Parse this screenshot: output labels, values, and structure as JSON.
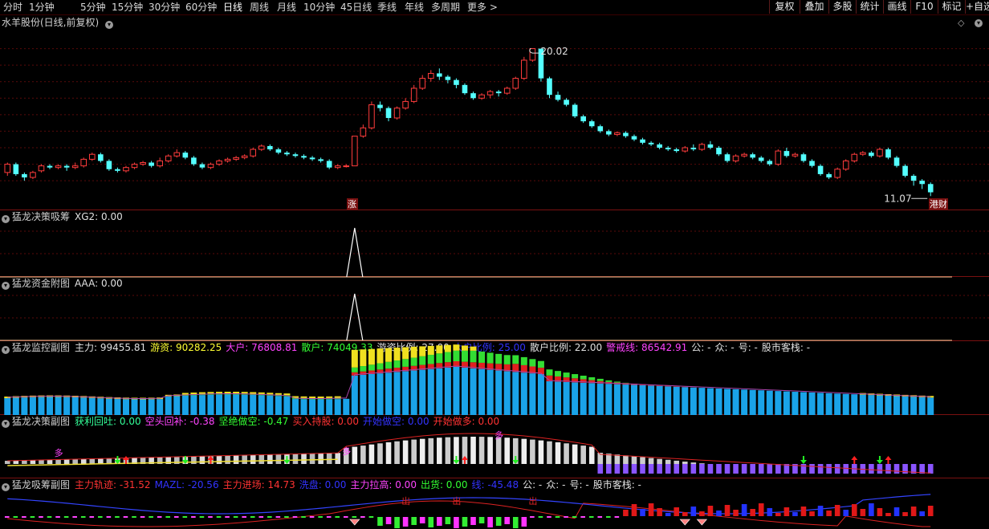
{
  "toolbar": {
    "periods": [
      "分时",
      "1分钟",
      "5分钟",
      "15分钟",
      "30分钟",
      "60分钟",
      "日线",
      "周线",
      "月线",
      "10分钟",
      "45日线",
      "季线",
      "年线",
      "多周期",
      "更多 >"
    ],
    "active_period": "日线",
    "right_buttons": [
      "复权",
      "叠加",
      "多股",
      "统计",
      "画线",
      "F10",
      "标记",
      "+自选"
    ]
  },
  "main_panel": {
    "stock_title": "水羊股份(日线,前复权)",
    "high_label": "20.02",
    "low_label": "11.07",
    "zhang_badge": "涨",
    "finance_badge": "港财",
    "colors": {
      "up": "#ff3c3c",
      "down": "#54ffff",
      "bg": "#000000",
      "grid": "#5a0a0a"
    }
  },
  "panels": {
    "xg2": {
      "name": "猛龙决策吸筹",
      "items": [
        {
          "label": "XG2:",
          "value": "0.00",
          "color": "#e0e0e0"
        }
      ]
    },
    "aaa": {
      "name": "猛龙资金附图",
      "items": [
        {
          "label": "AAA:",
          "value": "0.00",
          "color": "#e0e0e0"
        }
      ]
    },
    "monitor": {
      "name": "猛龙监控副图",
      "items": [
        {
          "label": "主力:",
          "value": "99455.81",
          "color": "#e0e0e0"
        },
        {
          "label": "游资:",
          "value": "90282.25",
          "color": "#ffff33"
        },
        {
          "label": "大户:",
          "value": "76808.81",
          "color": "#ff44ff"
        },
        {
          "label": "散户:",
          "value": "74049.33",
          "color": "#33ff33"
        },
        {
          "label": "游资比例:",
          "value": "27.00",
          "color": "#e0e0e0"
        },
        {
          "label": "大户比例:",
          "value": "25.00",
          "color": "#3333ff"
        },
        {
          "label": "散户比例:",
          "value": "22.00",
          "color": "#e0e0e0"
        },
        {
          "label": "警戒线:",
          "value": "86542.91",
          "color": "#ff44ff"
        },
        {
          "label": "公:",
          "value": "-",
          "color": "#e0e0e0"
        },
        {
          "label": "众:",
          "value": "-",
          "color": "#e0e0e0"
        },
        {
          "label": "号:",
          "value": "-",
          "color": "#e0e0e0"
        },
        {
          "label": "股市客栈:",
          "value": "-",
          "color": "#e0e0e0"
        }
      ]
    },
    "decision": {
      "name": "猛龙决策副图",
      "items": [
        {
          "label": "获利回吐:",
          "value": "0.00",
          "color": "#33ff99"
        },
        {
          "label": "空头回补:",
          "value": "-0.38",
          "color": "#ff44ff"
        },
        {
          "label": "坚绝做空:",
          "value": "-0.47",
          "color": "#33ff33"
        },
        {
          "label": "买入持股:",
          "value": "0.00",
          "color": "#ff3333"
        },
        {
          "label": "开始做空:",
          "value": "0.00",
          "color": "#3333ff"
        },
        {
          "label": "开始做多:",
          "value": "0.00",
          "color": "#ff3333"
        }
      ]
    },
    "absorb": {
      "name": "猛龙吸筹副图",
      "items": [
        {
          "label": "主力轨迹:",
          "value": "-31.52",
          "color": "#ff3333"
        },
        {
          "label": "MAZL:",
          "value": "-20.56",
          "color": "#3333ff"
        },
        {
          "label": "主力进场:",
          "value": "14.73",
          "color": "#ff3333"
        },
        {
          "label": "洗盘:",
          "value": "0.00",
          "color": "#3333ff"
        },
        {
          "label": "主力拉高:",
          "value": "0.00",
          "color": "#ff44ff"
        },
        {
          "label": "出货:",
          "value": "0.00",
          "color": "#33ff33"
        },
        {
          "label": "线:",
          "value": "-45.48",
          "color": "#3333ff"
        },
        {
          "label": "公:",
          "value": "-",
          "color": "#e0e0e0"
        },
        {
          "label": "众:",
          "value": "-",
          "color": "#e0e0e0"
        },
        {
          "label": "号:",
          "value": "-",
          "color": "#e0e0e0"
        },
        {
          "label": "股市客栈:",
          "value": "-",
          "color": "#e0e0e0"
        }
      ]
    }
  },
  "decision_marks": {
    "duo": "多",
    "chu": "出"
  },
  "chart_data": {
    "type": "candlestick",
    "price_ylim": [
      10.5,
      21.0
    ],
    "high": 20.02,
    "low": 11.07,
    "candles": [
      [
        12.5,
        13.0,
        12.3,
        13.1
      ],
      [
        13.0,
        12.4,
        12.3,
        13.1
      ],
      [
        12.4,
        12.2,
        12.0,
        12.5
      ],
      [
        12.2,
        12.5,
        12.1,
        12.6
      ],
      [
        12.6,
        12.9,
        12.5,
        13.0
      ],
      [
        12.9,
        12.8,
        12.7,
        13.0
      ],
      [
        12.8,
        12.9,
        12.7,
        13.0
      ],
      [
        12.9,
        12.8,
        12.6,
        13.0
      ],
      [
        12.8,
        12.9,
        12.7,
        13.1
      ],
      [
        12.9,
        13.3,
        12.8,
        13.4
      ],
      [
        13.3,
        13.6,
        13.2,
        13.7
      ],
      [
        13.6,
        13.2,
        13.1,
        13.7
      ],
      [
        13.2,
        12.7,
        12.6,
        13.3
      ],
      [
        12.7,
        12.6,
        12.5,
        12.8
      ],
      [
        12.6,
        12.8,
        12.5,
        12.9
      ],
      [
        12.8,
        13.0,
        12.7,
        13.1
      ],
      [
        13.0,
        13.1,
        12.9,
        13.2
      ],
      [
        13.1,
        12.9,
        12.8,
        13.2
      ],
      [
        12.9,
        13.2,
        12.8,
        13.4
      ],
      [
        13.2,
        13.5,
        13.1,
        13.6
      ],
      [
        13.5,
        13.7,
        13.4,
        13.9
      ],
      [
        13.7,
        13.4,
        13.3,
        13.8
      ],
      [
        13.4,
        13.0,
        12.9,
        13.5
      ],
      [
        13.0,
        12.8,
        12.7,
        13.1
      ],
      [
        12.8,
        13.0,
        12.7,
        13.1
      ],
      [
        13.0,
        13.2,
        12.9,
        13.3
      ],
      [
        13.2,
        13.3,
        13.1,
        13.4
      ],
      [
        13.3,
        13.4,
        13.2,
        13.5
      ],
      [
        13.4,
        13.5,
        13.3,
        13.6
      ],
      [
        13.5,
        13.9,
        13.4,
        14.0
      ],
      [
        13.9,
        14.1,
        13.8,
        14.2
      ],
      [
        14.1,
        13.9,
        13.8,
        14.2
      ],
      [
        13.9,
        13.7,
        13.6,
        14.0
      ],
      [
        13.7,
        13.6,
        13.5,
        13.8
      ],
      [
        13.6,
        13.5,
        13.4,
        13.7
      ],
      [
        13.5,
        13.4,
        13.3,
        13.6
      ],
      [
        13.4,
        13.3,
        13.2,
        13.5
      ],
      [
        13.3,
        13.2,
        13.1,
        13.4
      ],
      [
        13.2,
        12.8,
        12.7,
        13.3
      ],
      [
        12.8,
        12.9,
        12.7,
        13.0
      ],
      [
        12.9,
        12.9,
        12.8,
        13.0
      ],
      [
        12.9,
        14.7,
        12.9,
        14.7
      ],
      [
        14.7,
        15.2,
        14.6,
        15.4
      ],
      [
        15.2,
        16.6,
        15.1,
        16.8
      ],
      [
        16.6,
        16.4,
        16.2,
        16.8
      ],
      [
        16.4,
        15.8,
        15.6,
        16.5
      ],
      [
        15.8,
        16.4,
        15.7,
        16.5
      ],
      [
        16.4,
        16.8,
        16.3,
        17.0
      ],
      [
        16.8,
        17.6,
        16.7,
        17.8
      ],
      [
        17.6,
        18.2,
        17.5,
        18.4
      ],
      [
        18.2,
        18.5,
        18.0,
        18.7
      ],
      [
        18.5,
        18.3,
        18.1,
        18.8
      ],
      [
        18.3,
        18.1,
        17.9,
        18.4
      ],
      [
        18.1,
        17.8,
        17.6,
        18.2
      ],
      [
        17.8,
        17.3,
        17.2,
        17.9
      ],
      [
        17.3,
        17.0,
        16.9,
        17.4
      ],
      [
        17.0,
        17.2,
        16.9,
        17.3
      ],
      [
        17.2,
        17.4,
        17.0,
        17.5
      ],
      [
        17.4,
        17.3,
        17.1,
        17.5
      ],
      [
        17.3,
        17.6,
        17.2,
        17.7
      ],
      [
        17.6,
        18.2,
        17.5,
        18.3
      ],
      [
        18.2,
        19.3,
        18.1,
        19.5
      ],
      [
        19.3,
        20.0,
        19.2,
        20.02
      ],
      [
        20.0,
        18.2,
        18.0,
        20.0
      ],
      [
        18.2,
        17.2,
        17.0,
        18.3
      ],
      [
        17.2,
        16.9,
        16.8,
        17.4
      ],
      [
        16.9,
        16.6,
        16.5,
        17.0
      ],
      [
        16.6,
        15.9,
        15.8,
        16.7
      ],
      [
        15.9,
        15.6,
        15.5,
        16.0
      ],
      [
        15.6,
        15.3,
        15.2,
        15.7
      ],
      [
        15.3,
        15.0,
        14.9,
        15.4
      ],
      [
        15.0,
        14.8,
        14.7,
        15.1
      ],
      [
        14.8,
        14.9,
        14.7,
        15.0
      ],
      [
        14.9,
        14.7,
        14.6,
        15.0
      ],
      [
        14.7,
        14.5,
        14.4,
        14.8
      ],
      [
        14.5,
        14.3,
        14.2,
        14.6
      ],
      [
        14.3,
        14.2,
        14.1,
        14.4
      ],
      [
        14.2,
        14.0,
        13.9,
        14.3
      ],
      [
        14.0,
        13.9,
        13.8,
        14.1
      ],
      [
        13.9,
        13.8,
        13.7,
        14.0
      ],
      [
        13.8,
        14.0,
        13.7,
        14.1
      ],
      [
        14.0,
        13.9,
        13.8,
        14.2
      ],
      [
        13.9,
        14.2,
        13.8,
        14.3
      ],
      [
        14.2,
        14.0,
        13.9,
        14.4
      ],
      [
        14.0,
        13.6,
        13.5,
        14.1
      ],
      [
        13.6,
        13.2,
        13.1,
        13.7
      ],
      [
        13.2,
        13.5,
        13.1,
        13.6
      ],
      [
        13.5,
        13.6,
        13.4,
        13.7
      ],
      [
        13.6,
        13.4,
        13.3,
        13.7
      ],
      [
        13.4,
        13.2,
        13.1,
        13.5
      ],
      [
        13.2,
        13.0,
        12.9,
        13.3
      ],
      [
        13.0,
        13.8,
        12.9,
        13.9
      ],
      [
        13.8,
        13.5,
        13.4,
        14.0
      ],
      [
        13.5,
        13.6,
        13.4,
        13.7
      ],
      [
        13.6,
        13.2,
        13.1,
        13.7
      ],
      [
        13.2,
        12.9,
        12.8,
        13.3
      ],
      [
        12.9,
        12.4,
        12.3,
        13.0
      ],
      [
        12.4,
        12.2,
        12.1,
        12.5
      ],
      [
        12.2,
        12.7,
        12.1,
        12.8
      ],
      [
        12.7,
        13.2,
        12.6,
        13.3
      ],
      [
        13.2,
        13.6,
        13.1,
        13.7
      ],
      [
        13.6,
        13.7,
        13.5,
        13.8
      ],
      [
        13.7,
        13.5,
        13.4,
        13.8
      ],
      [
        13.5,
        13.9,
        13.4,
        14.0
      ],
      [
        13.9,
        13.4,
        13.3,
        14.0
      ],
      [
        13.4,
        12.9,
        12.8,
        13.5
      ],
      [
        12.9,
        12.3,
        12.2,
        13.0
      ],
      [
        12.3,
        12.0,
        11.7,
        12.4
      ],
      [
        12.0,
        11.8,
        11.5,
        12.1
      ],
      [
        11.8,
        11.3,
        11.07,
        11.9
      ]
    ]
  }
}
